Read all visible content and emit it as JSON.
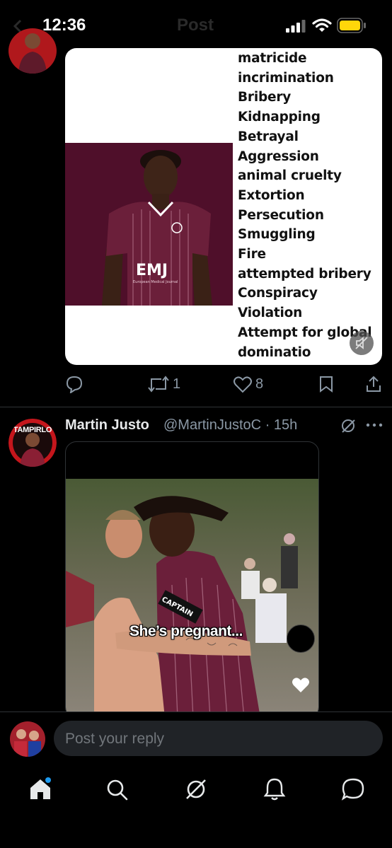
{
  "status_bar": {
    "time": "12:36",
    "ghost_title": "Post"
  },
  "tweet1": {
    "media": {
      "crimes": [
        "matricide",
        "incrimination",
        "Bribery",
        "Kidnapping",
        "Betrayal",
        "Aggression",
        "animal cruelty",
        "Extortion",
        "Persecution",
        "Smuggling",
        "Fire",
        "attempted bribery",
        "Conspiracy",
        "Violation",
        "Attempt for global",
        "dominatio"
      ],
      "shirt_sponsor": "EMJ",
      "shirt_sponsor_sub": "European Medical Journal"
    },
    "actions": {
      "reply_count": "",
      "repost_count": "1",
      "like_count": "8"
    }
  },
  "tweet2": {
    "avatar_label": "TAMPIRLO",
    "name": "Martin Justo",
    "handle": "@MartinJustoC",
    "separator": "·",
    "time": "15h",
    "media": {
      "caption": "She’s pregnant...",
      "armband": "CAPTAIN"
    }
  },
  "reply": {
    "placeholder": "Post your reply"
  },
  "colors": {
    "accent": "#1d9bf0",
    "maroon": "#6b1f3a",
    "muted": "#8b98a5"
  },
  "tab_bar": {
    "icons": [
      "home-icon",
      "search-icon",
      "grok-icon",
      "notifications-icon",
      "messages-icon"
    ]
  }
}
